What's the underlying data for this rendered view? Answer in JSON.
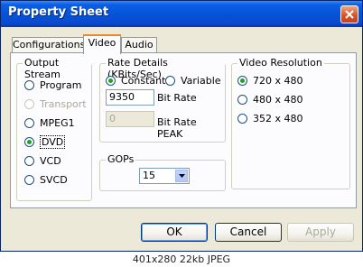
{
  "window": {
    "title": "Property Sheet"
  },
  "tabs": [
    {
      "label": "Configurations",
      "active": false
    },
    {
      "label": "Video",
      "active": true
    },
    {
      "label": "Audio",
      "active": false
    }
  ],
  "output_stream": {
    "legend": "Output Stream",
    "options": [
      {
        "label": "Program",
        "checked": false,
        "disabled": false
      },
      {
        "label": "Transport",
        "checked": false,
        "disabled": true
      },
      {
        "label": "MPEG1",
        "checked": false,
        "disabled": false
      },
      {
        "label": "DVD",
        "checked": true,
        "disabled": false
      },
      {
        "label": "VCD",
        "checked": false,
        "disabled": false
      },
      {
        "label": "SVCD",
        "checked": false,
        "disabled": false
      }
    ]
  },
  "rate_details": {
    "legend": "Rate Details (KBits/Sec)",
    "constant_label": "Constant",
    "variable_label": "Variable",
    "selected": "Constant",
    "bit_rate_value": "9350",
    "bit_rate_label": "Bit Rate",
    "bit_rate_peak_value": "0",
    "bit_rate_peak_label": "Bit Rate PEAK"
  },
  "gops": {
    "legend": "GOPs",
    "value": "15"
  },
  "video_resolution": {
    "legend": "Video Resolution",
    "options": [
      {
        "label": "720 x 480",
        "checked": true
      },
      {
        "label": "480 x 480",
        "checked": false
      },
      {
        "label": "352 x 480",
        "checked": false
      }
    ]
  },
  "buttons": {
    "ok": "OK",
    "cancel": "Cancel",
    "apply": "Apply"
  },
  "caption": "401x280 22kb JPEG"
}
